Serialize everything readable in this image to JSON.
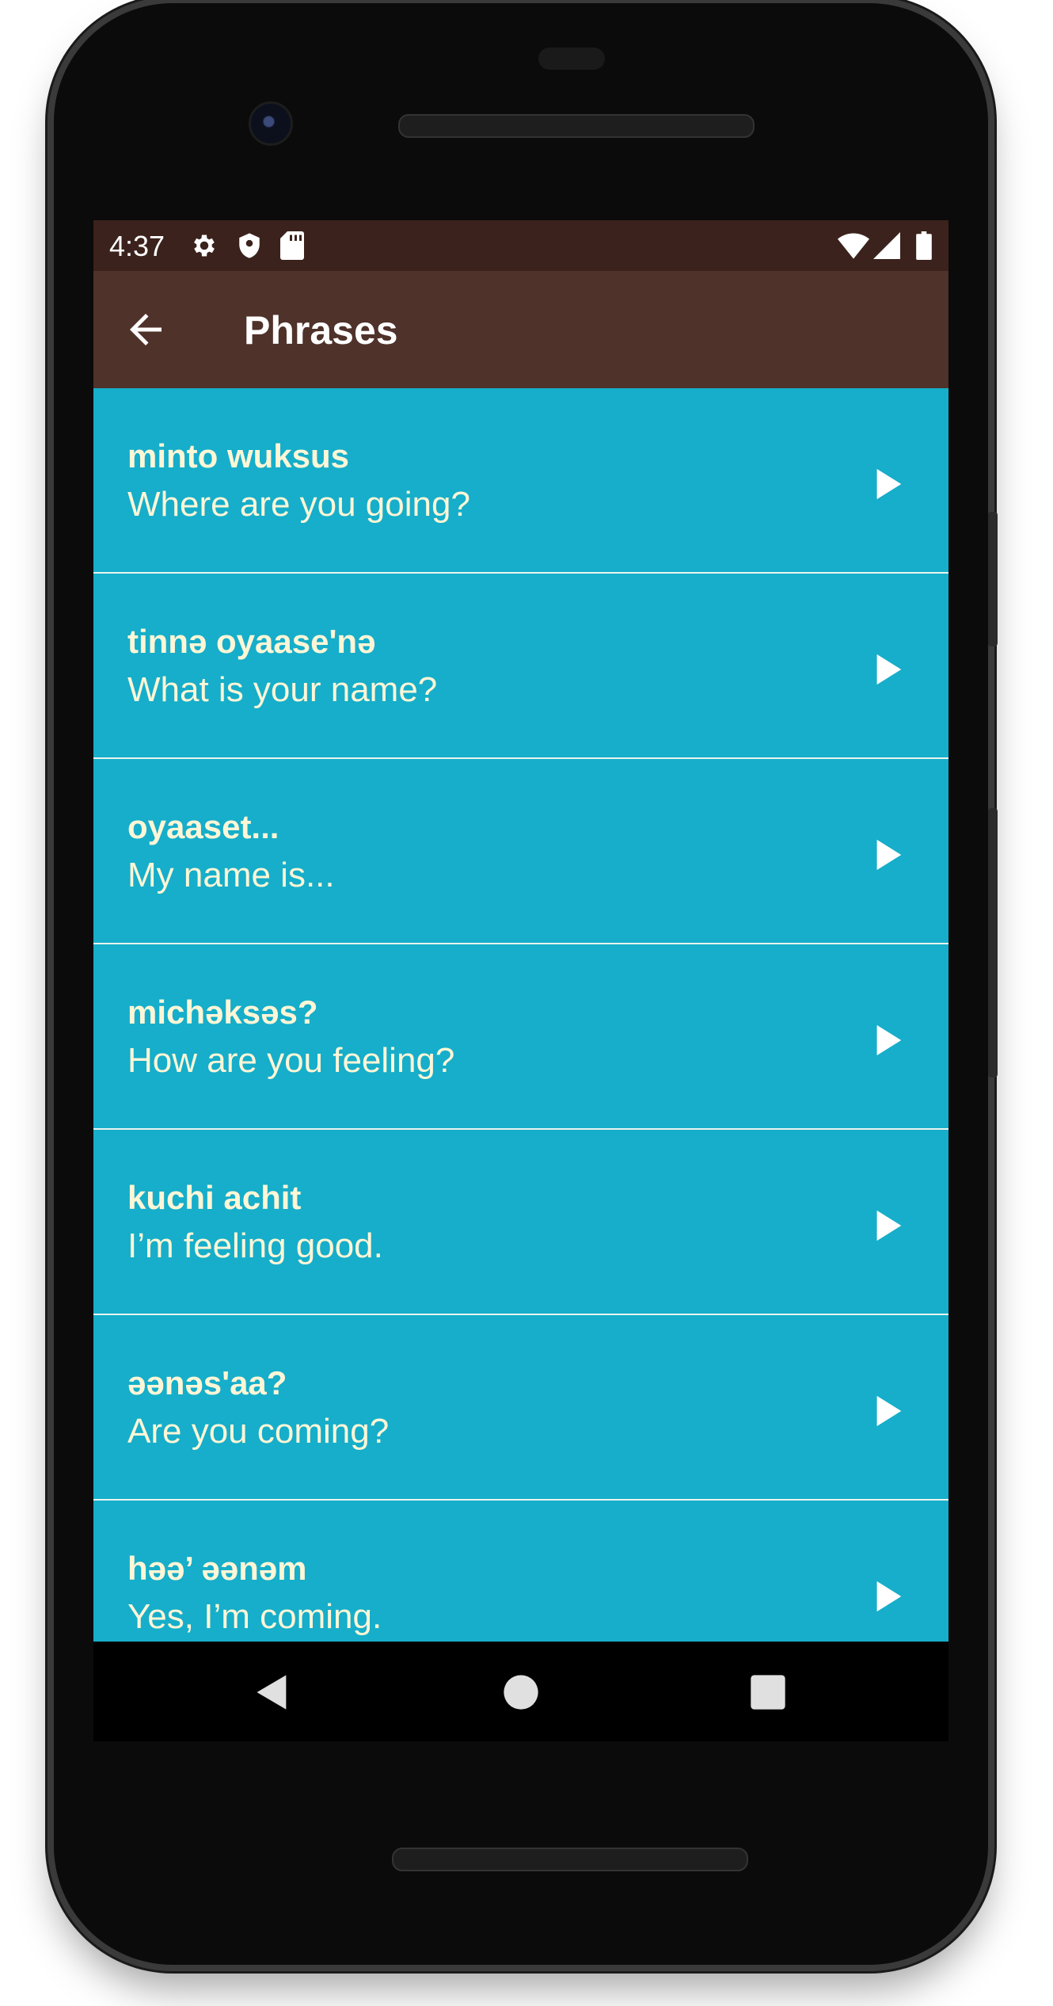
{
  "status_bar": {
    "time": "4:37",
    "icons_left": [
      "settings-icon",
      "shield-icon",
      "sd-card-icon"
    ],
    "icons_right": [
      "wifi-icon",
      "signal-icon",
      "battery-icon"
    ]
  },
  "app_bar": {
    "title": "Phrases",
    "back_icon": "arrow-back-icon",
    "background_color": "#4f322a",
    "status_color": "#3b221c"
  },
  "list": {
    "background_color": "#16aeca",
    "text_color": "#fff6d6",
    "items": [
      {
        "phrase": "minto wuksus",
        "translation": "Where are you going?"
      },
      {
        "phrase": "tinnə oyaase'nə",
        "translation": "What is your name?"
      },
      {
        "phrase": "oyaaset...",
        "translation": "My name is..."
      },
      {
        "phrase": "michəksəs?",
        "translation": "How are you feeling?"
      },
      {
        "phrase": "kuchi achit",
        "translation": "I’m feeling good."
      },
      {
        "phrase": "əənəs'aa?",
        "translation": "Are you coming?"
      },
      {
        "phrase": "həə’ əənəm",
        "translation": "Yes, I’m coming."
      }
    ]
  },
  "nav_bar": {
    "buttons": [
      "back-triangle-icon",
      "home-circle-icon",
      "recents-square-icon"
    ]
  }
}
